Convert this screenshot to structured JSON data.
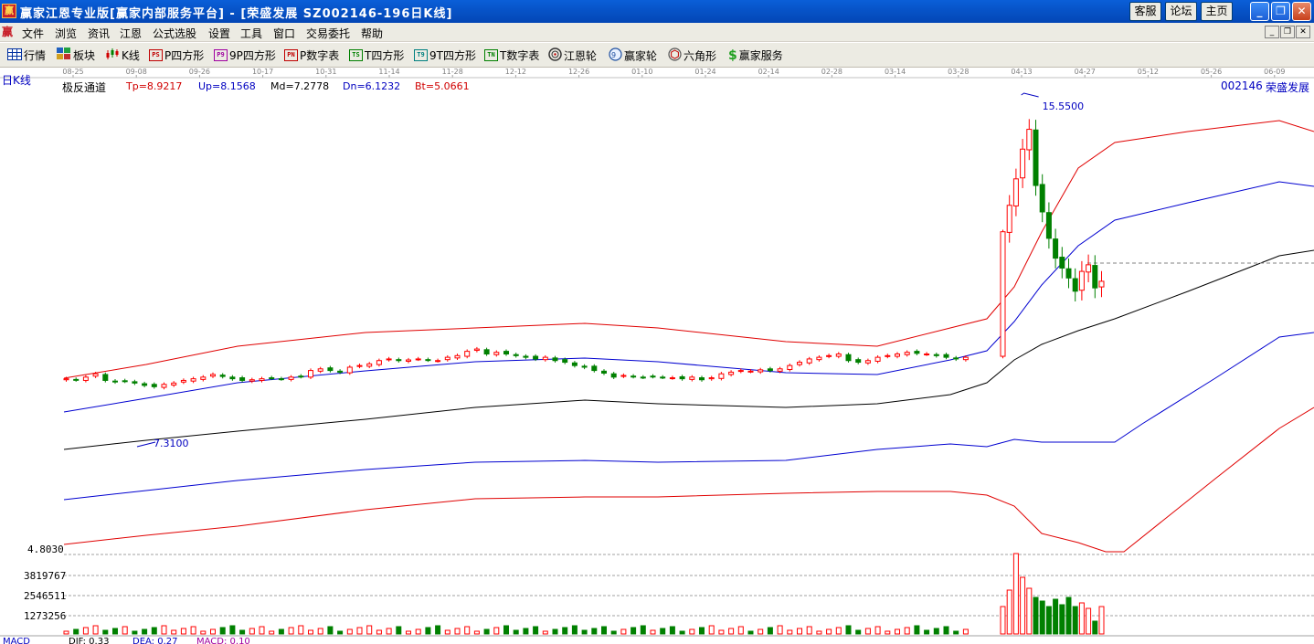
{
  "titlebar": {
    "logo": "赢",
    "title": "赢家江恩专业版[赢家内部服务平台] - [荣盛发展  SZ002146-196日K线]",
    "buttons": [
      "客服",
      "论坛",
      "主页"
    ]
  },
  "menubar": {
    "logo": "赢",
    "items": [
      "文件",
      "浏览",
      "资讯",
      "江恩",
      "公式选股",
      "设置",
      "工具",
      "窗口",
      "交易委托",
      "帮助"
    ]
  },
  "toolbar": {
    "items": [
      {
        "label": "行情",
        "icon": "grid-icon"
      },
      {
        "label": "板块",
        "icon": "blocks-icon"
      },
      {
        "label": "K线",
        "icon": "kline-icon"
      },
      {
        "label": "P四方形",
        "icon": "ps-icon",
        "badge": "PS"
      },
      {
        "label": "9P四方形",
        "icon": "p9-icon",
        "badge": "P9"
      },
      {
        "label": "P数字表",
        "icon": "pn-icon",
        "badge": "PN"
      },
      {
        "label": "T四方形",
        "icon": "ts-icon",
        "badge": "TS"
      },
      {
        "label": "9T四方形",
        "icon": "t9-icon",
        "badge": "T9"
      },
      {
        "label": "T数字表",
        "icon": "tn-icon",
        "badge": "TN"
      },
      {
        "label": "江恩轮",
        "icon": "gann-wheel-icon"
      },
      {
        "label": "赢家轮",
        "icon": "winner-wheel-icon"
      },
      {
        "label": "六角形",
        "icon": "hexagon-icon"
      },
      {
        "label": "赢家服务",
        "icon": "dollar-icon"
      }
    ]
  },
  "chart": {
    "period_label": "日K线",
    "indicator_name": "极反通道",
    "indicator_values": [
      {
        "label": "Tp=8.9217",
        "color": "#d00000"
      },
      {
        "label": "Up=8.1568",
        "color": "#0000c0"
      },
      {
        "label": "Md=7.2778",
        "color": "#000000"
      },
      {
        "label": "Dn=6.1232",
        "color": "#0000c0"
      },
      {
        "label": "Bt=5.0661",
        "color": "#d00000"
      }
    ],
    "stock_code": "002146",
    "stock_name": "荣盛发展",
    "date_ticks": [
      "08-25",
      "09-08",
      "09-26",
      "10-17",
      "10-31",
      "11-14",
      "11-28",
      "12-12",
      "12-26",
      "01-10",
      "01-24",
      "02-14",
      "02-28",
      "03-14",
      "03-28",
      "04-13",
      "04-27",
      "05-12",
      "05-26",
      "06-09"
    ],
    "high_marker": "15.5500",
    "low_marker": "7.3100",
    "price_axis_label": "4.8030",
    "volume_axis_labels": [
      "3819767",
      "2546511",
      "1273256"
    ],
    "macd_row": {
      "name": "MACD",
      "dif": "DIF: 0.33",
      "dea": "DEA: 0.27",
      "macd": "MACD: 0.10"
    },
    "colors": {
      "up": "#ff0000",
      "down": "#008000",
      "channel_outer": "#e00000",
      "channel_inner": "#0000d0",
      "channel_mid": "#000000"
    }
  },
  "chart_data": {
    "type": "candlestick",
    "title": "荣盛发展 SZ002146 日K线",
    "x_tick_labels": [
      "08-25",
      "09-08",
      "09-26",
      "10-17",
      "10-31",
      "11-14",
      "11-28",
      "12-12",
      "12-26",
      "01-10",
      "01-24",
      "02-14",
      "02-28",
      "03-14",
      "03-28",
      "04-13",
      "04-27",
      "05-12",
      "05-26",
      "06-09"
    ],
    "ohlc_series_close": [
      7.55,
      7.52,
      7.6,
      7.7,
      7.5,
      7.46,
      7.48,
      7.42,
      7.35,
      7.31,
      7.38,
      7.42,
      7.5,
      7.55,
      7.6,
      7.68,
      7.62,
      7.55,
      7.5,
      7.52,
      7.55,
      7.57,
      7.55,
      7.6,
      7.62,
      7.8,
      7.85,
      7.8,
      7.75,
      7.9,
      7.95,
      8.0,
      8.1,
      8.15,
      8.1,
      8.12,
      8.15,
      8.12,
      8.1,
      8.2,
      8.25,
      8.38,
      8.45,
      8.3,
      8.35,
      8.3,
      8.25,
      8.2,
      8.15,
      8.2,
      8.1,
      8.05,
      7.95,
      7.9,
      7.8,
      7.72,
      7.6,
      7.65,
      7.62,
      7.6,
      7.62,
      7.6,
      7.58,
      7.55,
      7.6,
      7.52,
      7.58,
      7.7,
      7.75,
      7.8,
      7.78,
      7.82,
      7.8,
      7.85,
      7.95,
      8.05,
      8.15,
      8.2,
      8.25,
      8.3,
      8.1,
      8.05,
      8.1,
      8.2,
      8.25,
      8.3,
      8.35,
      8.32,
      8.3,
      8.25,
      8.2,
      8.15,
      8.2,
      12.0,
      12.8,
      13.6,
      14.5,
      15.1,
      13.4,
      12.6,
      11.8,
      11.2,
      10.9,
      10.6,
      10.2,
      10.8,
      11.0,
      10.3,
      10.5
    ],
    "high_price": 15.55,
    "low_price": 7.31,
    "indicator": {
      "name": "极反通道",
      "Tp": 8.9217,
      "Up": 8.1568,
      "Md": 7.2778,
      "Dn": 6.1232,
      "Bt": 5.0661
    },
    "volume_axis": [
      1273256,
      2546511,
      3819767
    ],
    "price_axis_min_label": 4.803,
    "macd": {
      "DIF": 0.33,
      "DEA": 0.27,
      "MACD": 0.1
    }
  }
}
